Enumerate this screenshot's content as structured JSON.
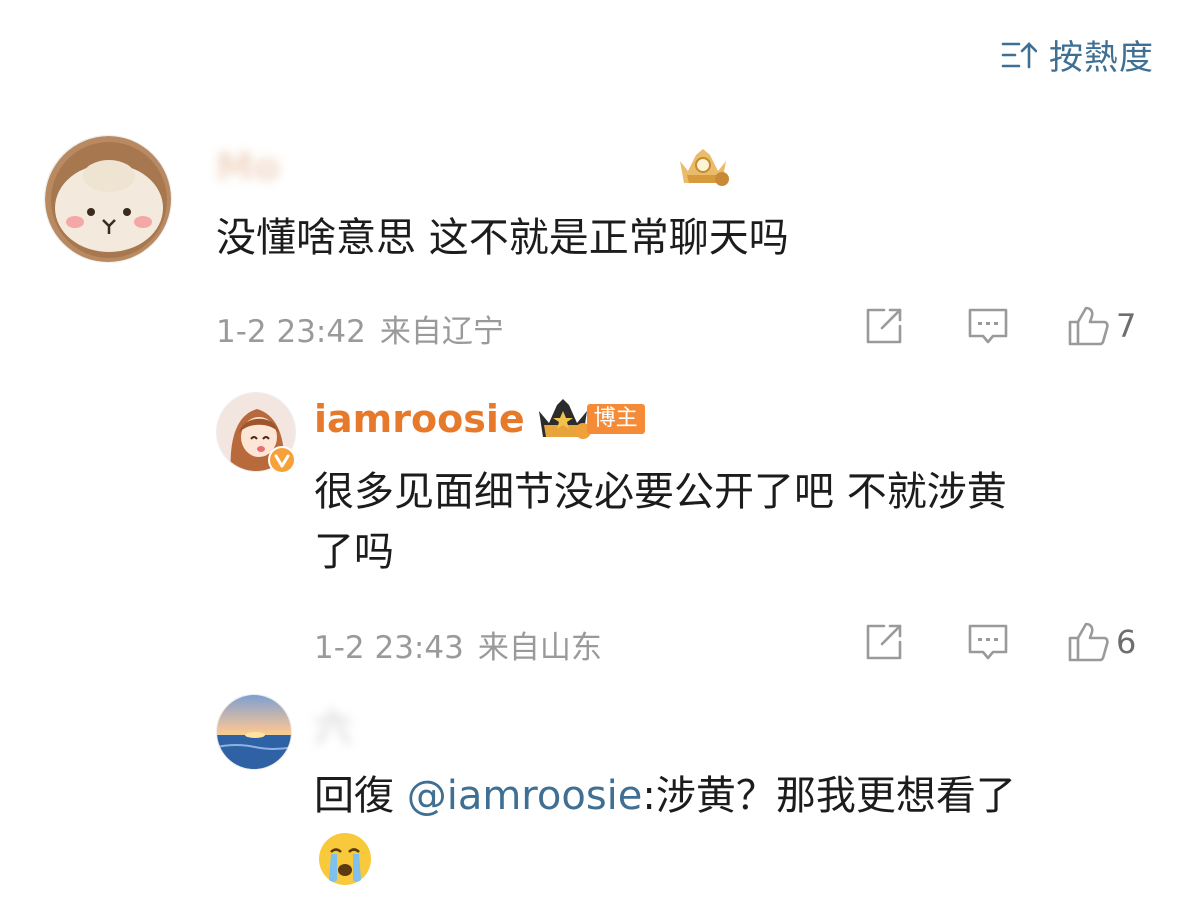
{
  "sort": {
    "label": "按熱度",
    "icon": "sort-icon"
  },
  "colors": {
    "link": "#3f6f93",
    "owner_name": "#e77a2a",
    "meta": "#9a9a9a"
  },
  "comments": [
    {
      "username": "Mo",
      "badge_icon": "crown-icon",
      "text": "没懂啥意思 这不就是正常聊天吗",
      "time": "1-2 23:42",
      "region": "来自辽宁",
      "likes": "7"
    },
    {
      "username": "iamroosie",
      "badge_icon": "crown-icon",
      "owner_tag": "博主",
      "verified_icon": "verified-icon",
      "text_line1": "很多见面细节没必要公开了吧 不就涉黄",
      "text_line2": "了吗",
      "time": "1-2 23:43",
      "region": "来自山东",
      "likes": "6"
    },
    {
      "username": "六",
      "text_prefix": "回復 ",
      "mention": "@iamroosie",
      "text_suffix": ":涉黄？那我更想看了",
      "emoji_icon": "crying-face-icon"
    }
  ]
}
